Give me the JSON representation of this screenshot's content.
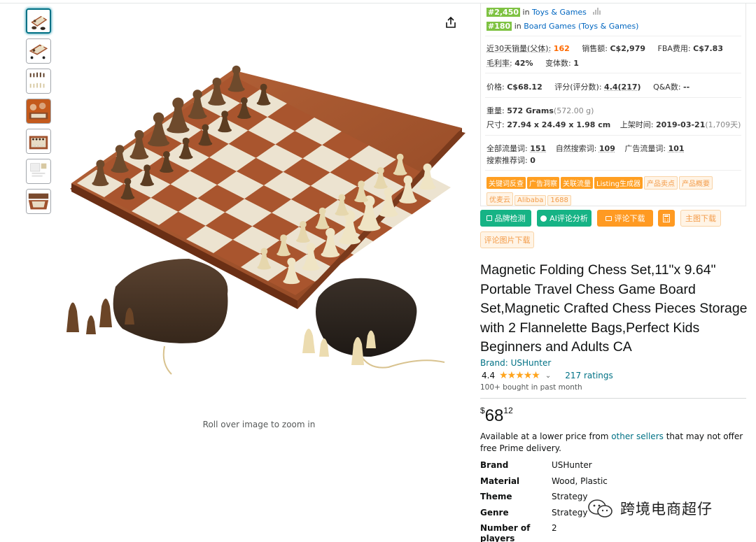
{
  "rankings": [
    {
      "rank": "#2,450",
      "prefix": "in",
      "category": "Toys & Games"
    },
    {
      "rank": "#180",
      "prefix": "in",
      "category": "Board Games (Toys & Games)"
    }
  ],
  "stats": {
    "sales30_label": "近30天销量(父体):",
    "sales30_value": "162",
    "revenue_label": "销售额:",
    "revenue_value": "C$2,979",
    "fba_label": "FBA费用:",
    "fba_value": "C$7.83",
    "margin_label": "毛利率:",
    "margin_value": "42%",
    "variants_label": "变体数:",
    "variants_value": "1",
    "price_label": "价格:",
    "price_value": "C$68.12",
    "score_label": "评分(评分数):",
    "score_value": "4.4(217)",
    "qa_label": "Q&A数:",
    "qa_value": "--",
    "weight_label": "重量:",
    "weight_value": "572 Grams",
    "weight_extra": "(572.00 g)",
    "size_label": "尺寸:",
    "size_value": "27.94 x 24.49 x 1.98 cm",
    "listed_label": "上架时间:",
    "listed_value": "2019-03-21",
    "listed_extra": "(1,709天)",
    "traffic_all_label": "全部流量词:",
    "traffic_all_value": "151",
    "organic_label": "自然搜索词:",
    "organic_value": "109",
    "ad_label": "广告流量词:",
    "ad_value": "101",
    "recommend_label": "搜索推荐词:",
    "recommend_value": "0"
  },
  "tags_solid": [
    "关键词反查",
    "广告洞察",
    "关联流量",
    "Listing生成器"
  ],
  "tags_outline": [
    "产品卖点",
    "产品概要",
    "优麦云",
    "Alibaba",
    "1688"
  ],
  "toolbar": {
    "brand_check": "品牌检测",
    "ai_review": "AI评论分析",
    "review_download": "评论下载",
    "main_image_download": "主图下载",
    "review_image_download": "评论图片下载"
  },
  "product": {
    "title": "Magnetic Folding Chess Set,11\"x 9.64\" Portable Travel Chess Game Board Set,Magnetic Crafted Chess Pieces Storage with 2 Flannelette Bags,Perfect Kids Beginners and Adults CA",
    "brand": "Brand: USHunter",
    "rating": "4.4",
    "stars": "★★★★★",
    "ratings_count": "217 ratings",
    "bought": "100+ bought in past month",
    "price_symbol": "$",
    "price_whole": "68",
    "price_fraction": "12",
    "avail_before": "Available at a lower price from ",
    "avail_link": "other sellers",
    "avail_after": " that may not offer free Prime delivery."
  },
  "zoom_hint": "Roll over image to zoom in",
  "specs": [
    {
      "key": "Brand",
      "value": "USHunter"
    },
    {
      "key": "Material",
      "value": "Wood, Plastic"
    },
    {
      "key": "Theme",
      "value": "Strategy"
    },
    {
      "key": "Genre",
      "value": "Strategy"
    },
    {
      "key": "Number of players",
      "value": "2"
    }
  ],
  "watermark": "跨境电商超仔",
  "colors": {
    "accent": "#007185",
    "star": "#ffa41c",
    "rank_green": "#7ec242",
    "plugin_orange": "#ff9a22",
    "plugin_green": "#16b385"
  }
}
